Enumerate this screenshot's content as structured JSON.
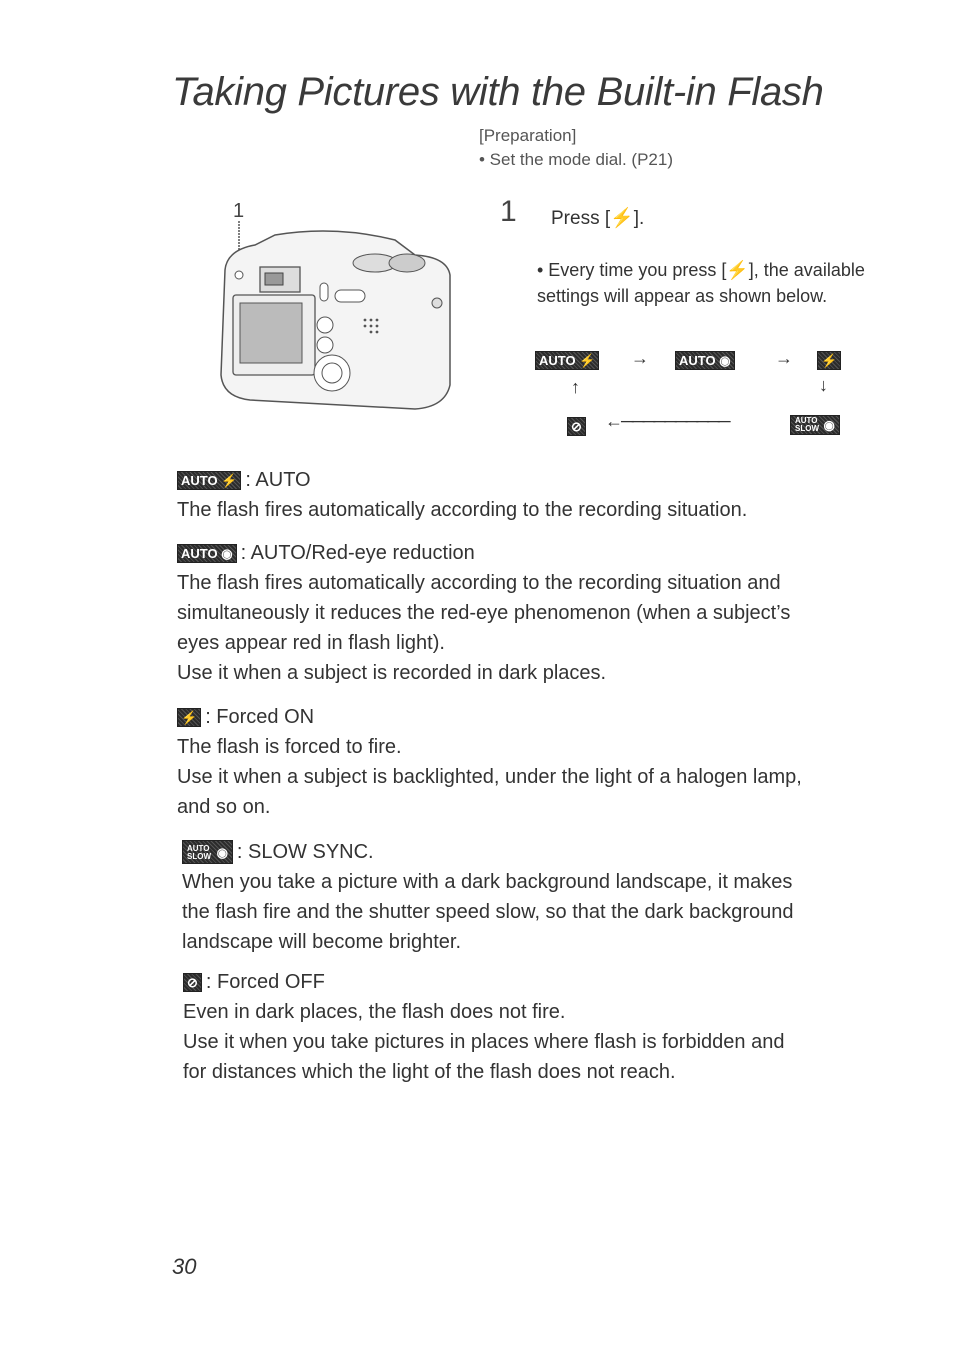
{
  "page": {
    "title": "Taking Pictures with the Built-in Flash",
    "preparation_label": "[Preparation]",
    "preparation_item": "• Set the mode dial. (P21)",
    "page_number": "30"
  },
  "illustration": {
    "callout_number": "1",
    "subject": "camera-rear-view"
  },
  "step": {
    "number": "1",
    "text": "Press [⚡].",
    "note": "• Every time you press [⚡], the available settings will appear as shown below."
  },
  "cycle_diagram": {
    "modes": [
      {
        "id": "auto",
        "badge": "AUTO ⚡"
      },
      {
        "id": "auto_redeye",
        "badge": "AUTO ◉"
      },
      {
        "id": "forced_on",
        "badge": "⚡"
      },
      {
        "id": "slow_sync",
        "badge_top": "AUTO",
        "badge_bottom": "SLOW",
        "badge_icon": "◉"
      },
      {
        "id": "forced_off",
        "badge": "⊘"
      }
    ],
    "arrows": [
      "→",
      "→",
      "↓",
      "←",
      "↑"
    ]
  },
  "sections": [
    {
      "badge": "AUTO ⚡",
      "heading": ": AUTO",
      "lines": [
        "The flash fires automatically according to the recording situation."
      ]
    },
    {
      "badge": "AUTO ◉",
      "heading": ": AUTO/Red-eye reduction",
      "lines": [
        "The flash fires automatically according to the recording situation and",
        "simultaneously it reduces the red-eye phenomenon (when a subject’s",
        "eyes appear red in flash light).",
        "Use it when a subject is recorded in dark places."
      ]
    },
    {
      "badge": "⚡",
      "heading": ": Forced ON",
      "lines": [
        "The flash is forced to fire.",
        "Use it when a subject is backlighted, under the light of a halogen lamp,",
        "and so on."
      ]
    },
    {
      "badge_top": "AUTO",
      "badge_bottom": "SLOW",
      "badge_icon": "◉",
      "heading": ": SLOW SYNC.",
      "lines": [
        "When you take a picture with a dark background landscape, it makes",
        "the flash fire and the shutter speed slow, so that the dark background",
        "landscape will become brighter."
      ]
    },
    {
      "badge": "⊘",
      "heading": ": Forced OFF",
      "lines": [
        "Even in dark places, the flash does not fire.",
        "Use it when you take pictures in places where flash is forbidden and",
        "for distances which the light of the flash does not reach."
      ]
    }
  ]
}
